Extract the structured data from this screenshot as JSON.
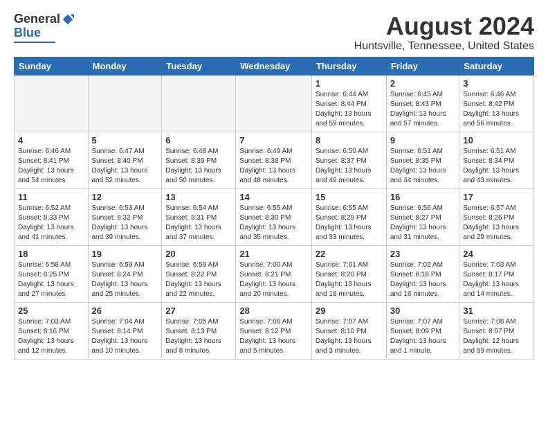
{
  "logo": {
    "general": "General",
    "blue": "Blue"
  },
  "title": "August 2024",
  "subtitle": "Huntsville, Tennessee, United States",
  "headers": [
    "Sunday",
    "Monday",
    "Tuesday",
    "Wednesday",
    "Thursday",
    "Friday",
    "Saturday"
  ],
  "weeks": [
    [
      {
        "day": "",
        "info": ""
      },
      {
        "day": "",
        "info": ""
      },
      {
        "day": "",
        "info": ""
      },
      {
        "day": "",
        "info": ""
      },
      {
        "day": "1",
        "info": "Sunrise: 6:44 AM\nSunset: 8:44 PM\nDaylight: 13 hours\nand 59 minutes."
      },
      {
        "day": "2",
        "info": "Sunrise: 6:45 AM\nSunset: 8:43 PM\nDaylight: 13 hours\nand 57 minutes."
      },
      {
        "day": "3",
        "info": "Sunrise: 6:46 AM\nSunset: 8:42 PM\nDaylight: 13 hours\nand 56 minutes."
      }
    ],
    [
      {
        "day": "4",
        "info": "Sunrise: 6:46 AM\nSunset: 8:41 PM\nDaylight: 13 hours\nand 54 minutes."
      },
      {
        "day": "5",
        "info": "Sunrise: 6:47 AM\nSunset: 8:40 PM\nDaylight: 13 hours\nand 52 minutes."
      },
      {
        "day": "6",
        "info": "Sunrise: 6:48 AM\nSunset: 8:39 PM\nDaylight: 13 hours\nand 50 minutes."
      },
      {
        "day": "7",
        "info": "Sunrise: 6:49 AM\nSunset: 8:38 PM\nDaylight: 13 hours\nand 48 minutes."
      },
      {
        "day": "8",
        "info": "Sunrise: 6:50 AM\nSunset: 8:37 PM\nDaylight: 13 hours\nand 46 minutes."
      },
      {
        "day": "9",
        "info": "Sunrise: 6:51 AM\nSunset: 8:35 PM\nDaylight: 13 hours\nand 44 minutes."
      },
      {
        "day": "10",
        "info": "Sunrise: 6:51 AM\nSunset: 8:34 PM\nDaylight: 13 hours\nand 43 minutes."
      }
    ],
    [
      {
        "day": "11",
        "info": "Sunrise: 6:52 AM\nSunset: 8:33 PM\nDaylight: 13 hours\nand 41 minutes."
      },
      {
        "day": "12",
        "info": "Sunrise: 6:53 AM\nSunset: 8:32 PM\nDaylight: 13 hours\nand 39 minutes."
      },
      {
        "day": "13",
        "info": "Sunrise: 6:54 AM\nSunset: 8:31 PM\nDaylight: 13 hours\nand 37 minutes."
      },
      {
        "day": "14",
        "info": "Sunrise: 6:55 AM\nSunset: 8:30 PM\nDaylight: 13 hours\nand 35 minutes."
      },
      {
        "day": "15",
        "info": "Sunrise: 6:55 AM\nSunset: 8:29 PM\nDaylight: 13 hours\nand 33 minutes."
      },
      {
        "day": "16",
        "info": "Sunrise: 6:56 AM\nSunset: 8:27 PM\nDaylight: 13 hours\nand 31 minutes."
      },
      {
        "day": "17",
        "info": "Sunrise: 6:57 AM\nSunset: 8:26 PM\nDaylight: 13 hours\nand 29 minutes."
      }
    ],
    [
      {
        "day": "18",
        "info": "Sunrise: 6:58 AM\nSunset: 8:25 PM\nDaylight: 13 hours\nand 27 minutes."
      },
      {
        "day": "19",
        "info": "Sunrise: 6:59 AM\nSunset: 8:24 PM\nDaylight: 13 hours\nand 25 minutes."
      },
      {
        "day": "20",
        "info": "Sunrise: 6:59 AM\nSunset: 8:22 PM\nDaylight: 13 hours\nand 22 minutes."
      },
      {
        "day": "21",
        "info": "Sunrise: 7:00 AM\nSunset: 8:21 PM\nDaylight: 13 hours\nand 20 minutes."
      },
      {
        "day": "22",
        "info": "Sunrise: 7:01 AM\nSunset: 8:20 PM\nDaylight: 13 hours\nand 18 minutes."
      },
      {
        "day": "23",
        "info": "Sunrise: 7:02 AM\nSunset: 8:18 PM\nDaylight: 13 hours\nand 16 minutes."
      },
      {
        "day": "24",
        "info": "Sunrise: 7:03 AM\nSunset: 8:17 PM\nDaylight: 13 hours\nand 14 minutes."
      }
    ],
    [
      {
        "day": "25",
        "info": "Sunrise: 7:03 AM\nSunset: 8:16 PM\nDaylight: 13 hours\nand 12 minutes."
      },
      {
        "day": "26",
        "info": "Sunrise: 7:04 AM\nSunset: 8:14 PM\nDaylight: 13 hours\nand 10 minutes."
      },
      {
        "day": "27",
        "info": "Sunrise: 7:05 AM\nSunset: 8:13 PM\nDaylight: 13 hours\nand 8 minutes."
      },
      {
        "day": "28",
        "info": "Sunrise: 7:06 AM\nSunset: 8:12 PM\nDaylight: 13 hours\nand 5 minutes."
      },
      {
        "day": "29",
        "info": "Sunrise: 7:07 AM\nSunset: 8:10 PM\nDaylight: 13 hours\nand 3 minutes."
      },
      {
        "day": "30",
        "info": "Sunrise: 7:07 AM\nSunset: 8:09 PM\nDaylight: 13 hours\nand 1 minute."
      },
      {
        "day": "31",
        "info": "Sunrise: 7:08 AM\nSunset: 8:07 PM\nDaylight: 12 hours\nand 59 minutes."
      }
    ]
  ]
}
